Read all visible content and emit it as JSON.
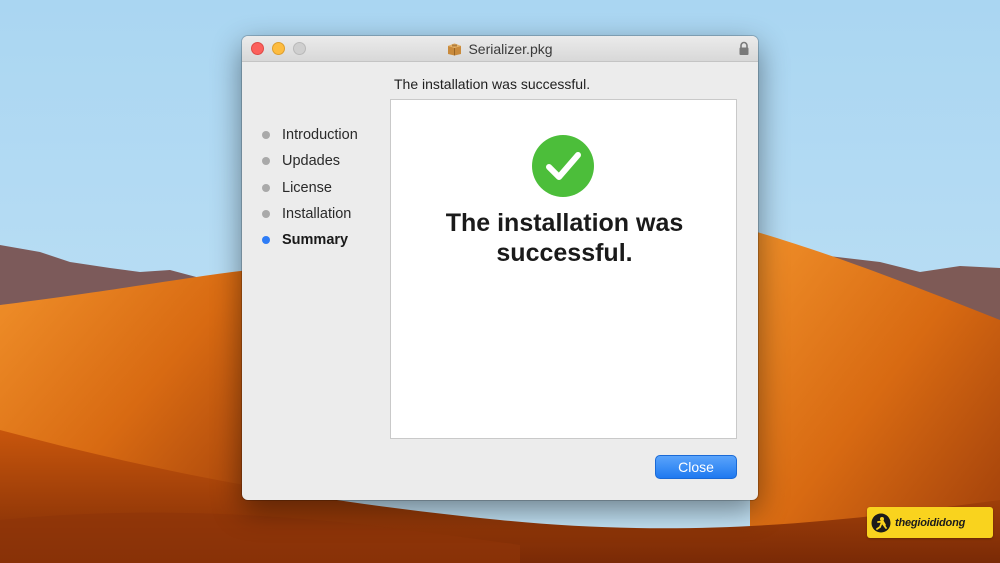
{
  "window": {
    "title": "Serializer.pkg",
    "header_text": "The installation was successful."
  },
  "sidebar": {
    "steps": [
      {
        "label": "Introduction",
        "active": false
      },
      {
        "label": "Updades",
        "active": false
      },
      {
        "label": "License",
        "active": false
      },
      {
        "label": "Installation",
        "active": false
      },
      {
        "label": "Summary",
        "active": true
      }
    ]
  },
  "content": {
    "message": "The installation was successful.",
    "icon": "checkmark-circle-icon",
    "icon_color": "#4cbe3a"
  },
  "buttons": {
    "close_label": "Close"
  },
  "watermark": {
    "text": "thegioididong"
  },
  "colors": {
    "accent": "#2e7cf6",
    "success": "#4cbe3a",
    "sky": "#b4dcf4",
    "dune": "#e07c1c"
  }
}
